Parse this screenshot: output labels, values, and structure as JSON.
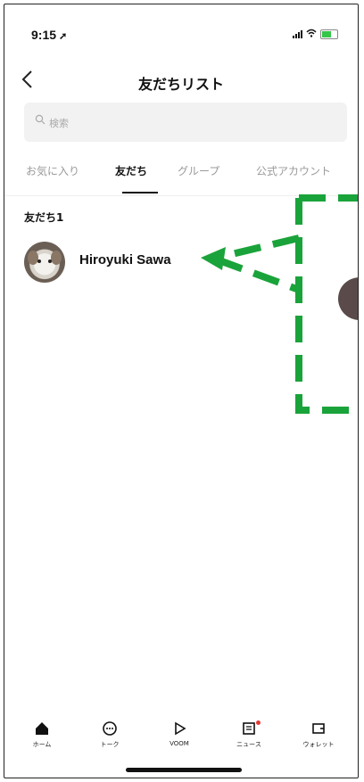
{
  "status_bar": {
    "time": "9:15",
    "location_arrow": "location-arrow-icon"
  },
  "header": {
    "title": "友だちリスト",
    "back_icon": "chevron-left-icon"
  },
  "search": {
    "placeholder": "検索"
  },
  "tabs": [
    {
      "label": "お気に入り",
      "active": false
    },
    {
      "label": "友だち",
      "active": true
    },
    {
      "label": "グループ",
      "active": false
    },
    {
      "label": "公式アカウント",
      "active": false
    }
  ],
  "section": {
    "label": "友だち1"
  },
  "friends": [
    {
      "name": "Hiroyuki Sawa",
      "avatar": "dog-photo"
    }
  ],
  "bottom_nav": [
    {
      "label": "ホーム",
      "icon": "home-icon"
    },
    {
      "label": "トーク",
      "icon": "chat-icon"
    },
    {
      "label": "VOOM",
      "icon": "play-icon"
    },
    {
      "label": "ニュース",
      "icon": "news-icon",
      "badge": true
    },
    {
      "label": "ウォレット",
      "icon": "wallet-icon"
    }
  ],
  "annotation": {
    "color": "#1aa33a"
  }
}
